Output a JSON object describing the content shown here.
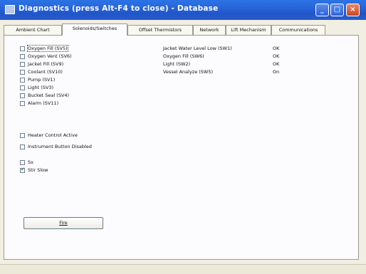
{
  "window": {
    "title": "Diagnostics  (press Alt-F4 to close) - Database"
  },
  "titlebar_buttons": {
    "minimize": "_",
    "maximize": "□",
    "close": "×"
  },
  "tabs": [
    {
      "label": "Ambient Chart"
    },
    {
      "label": "Solenoids/Switches"
    },
    {
      "label": "Offset Thermistors"
    },
    {
      "label": "Network"
    },
    {
      "label": "Lift Mechanism"
    },
    {
      "label": "Communications"
    }
  ],
  "solenoids": [
    {
      "label": "Oxygen Fill (SV5)",
      "checked": false
    },
    {
      "label": "Oxygen Vent (SV6)",
      "checked": false
    },
    {
      "label": "Jacket Fill (SV9)",
      "checked": false
    },
    {
      "label": "Coolant (SV10)",
      "checked": false
    },
    {
      "label": "Pump (SV1)",
      "checked": false
    },
    {
      "label": "Light (SV3)",
      "checked": false
    },
    {
      "label": "Bucket Seal (SV4)",
      "checked": false
    },
    {
      "label": "Alarm (SV11)",
      "checked": false
    }
  ],
  "controls": [
    {
      "label": "Heater Control Active",
      "checked": false
    },
    {
      "label": "Instrument Button Disabled",
      "checked": false
    }
  ],
  "misc": [
    {
      "label": "Sx",
      "checked": false
    },
    {
      "label": "Stir Slow",
      "checked": true
    }
  ],
  "status_rows": [
    {
      "label": "Jacket Water Level Low (SW1)",
      "value": "OK"
    },
    {
      "label": "Oxygen Fill (SW6)",
      "value": "OK"
    },
    {
      "label": "Light (SW2)",
      "value": "OK"
    },
    {
      "label": "Vessel Analyze (SW5)",
      "value": "On"
    }
  ],
  "fire_button": {
    "label": "Fire"
  },
  "colors": {
    "titlebar": "#2a68dd",
    "close_button": "#c94522"
  }
}
